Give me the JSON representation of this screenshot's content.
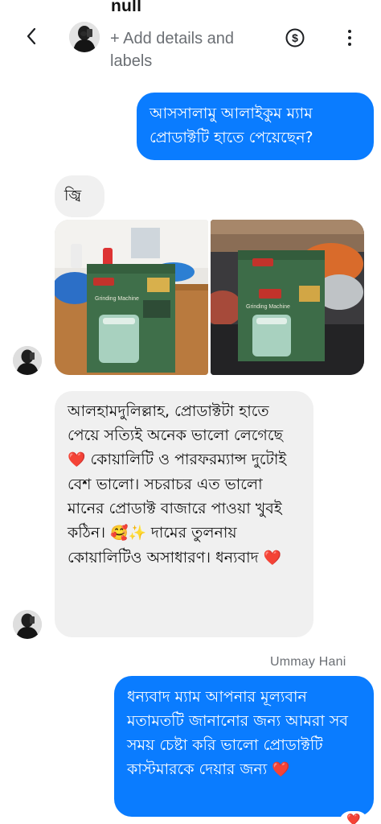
{
  "header": {
    "name": "null",
    "add_details": "+ Add details and labels",
    "back_icon": "chevron-left-icon",
    "dollar_icon": "dollar-circle-icon",
    "more_icon": "more-vertical-icon"
  },
  "messages": [
    {
      "direction": "outgoing",
      "text": "আসসালামু আলাইকুম ম্যাম প্রোডাক্টটি হাতে পেয়েছেন?"
    },
    {
      "direction": "incoming",
      "text": "জ্বি"
    },
    {
      "direction": "incoming",
      "type": "photos",
      "count": 2
    },
    {
      "direction": "incoming",
      "text_parts": [
        "আলহামদুলিল্লাহ, প্রোডাক্টটা হাতে পেয়ে সত্যিই অনেক ভালো লেগেছে ",
        "❤️",
        " কোয়ালিটি ও পারফরম্যান্স দুটোই বেশ ভালো। সচরাচর এত ভালো মানের প্রোডাক্ট বাজারে পাওয়া খুবই কঠিন। ",
        "🥰✨",
        " দামের তুলনায় কোয়ালিটিও অসাধারণ। ধন্যবাদ ",
        "❤️"
      ]
    },
    {
      "direction": "outgoing",
      "sender": "Ummay Hani",
      "text_parts": [
        "ধন্যবাদ ম্যাম আপনার মূল্যবান মতামতটি জানানোর জন্য আমরা সব সময় চেষ্টা করি ভালো প্রোডাক্টটি কাস্টমারকে দেয়ার জন্য ",
        "❤️"
      ],
      "reaction": "❤️"
    }
  ],
  "colors": {
    "outgoing_bubble": "#0a7cff",
    "incoming_bubble": "#f0f0f0",
    "heart": "#e6202a"
  }
}
